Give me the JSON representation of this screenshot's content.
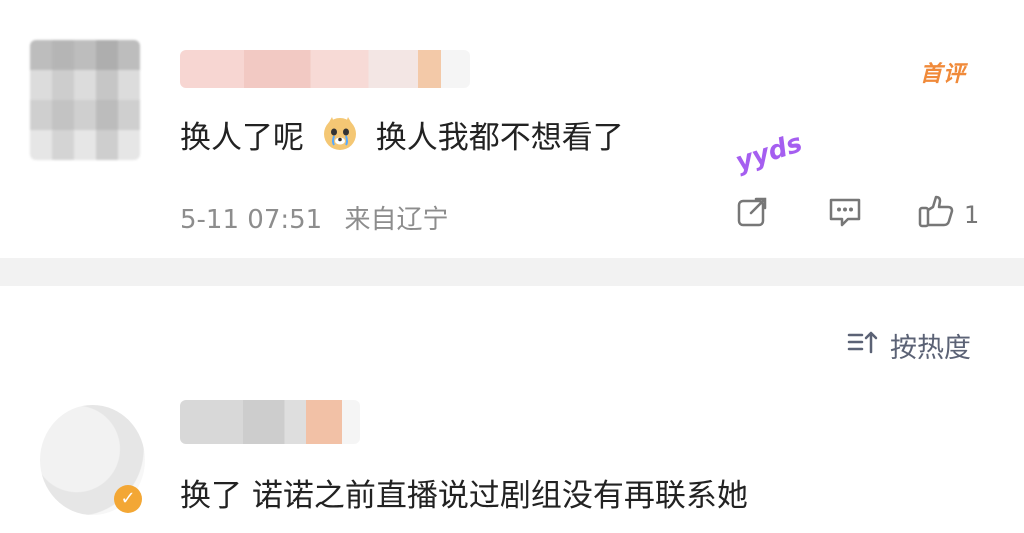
{
  "comments": [
    {
      "badge": "首评",
      "text_before": "换人了呢",
      "emoji": "crying-doge-emoji",
      "text_after": "换人我都不想看了",
      "decoration_text": "yyds",
      "time": "5-11 07:51",
      "location": "来自辽宁",
      "like_count": "1"
    },
    {
      "text": "换了 诺诺之前直播说过剧组没有再联系她"
    }
  ],
  "sort": {
    "label": "按热度",
    "icon": "sort-icon"
  },
  "icons": {
    "share": "share-icon",
    "comment": "comment-icon",
    "like": "thumbs-up-icon"
  },
  "colors": {
    "badge": "#f08a3a",
    "meta": "#8d8d8d",
    "divider": "#f2f2f2",
    "sort": "#5b6275"
  }
}
